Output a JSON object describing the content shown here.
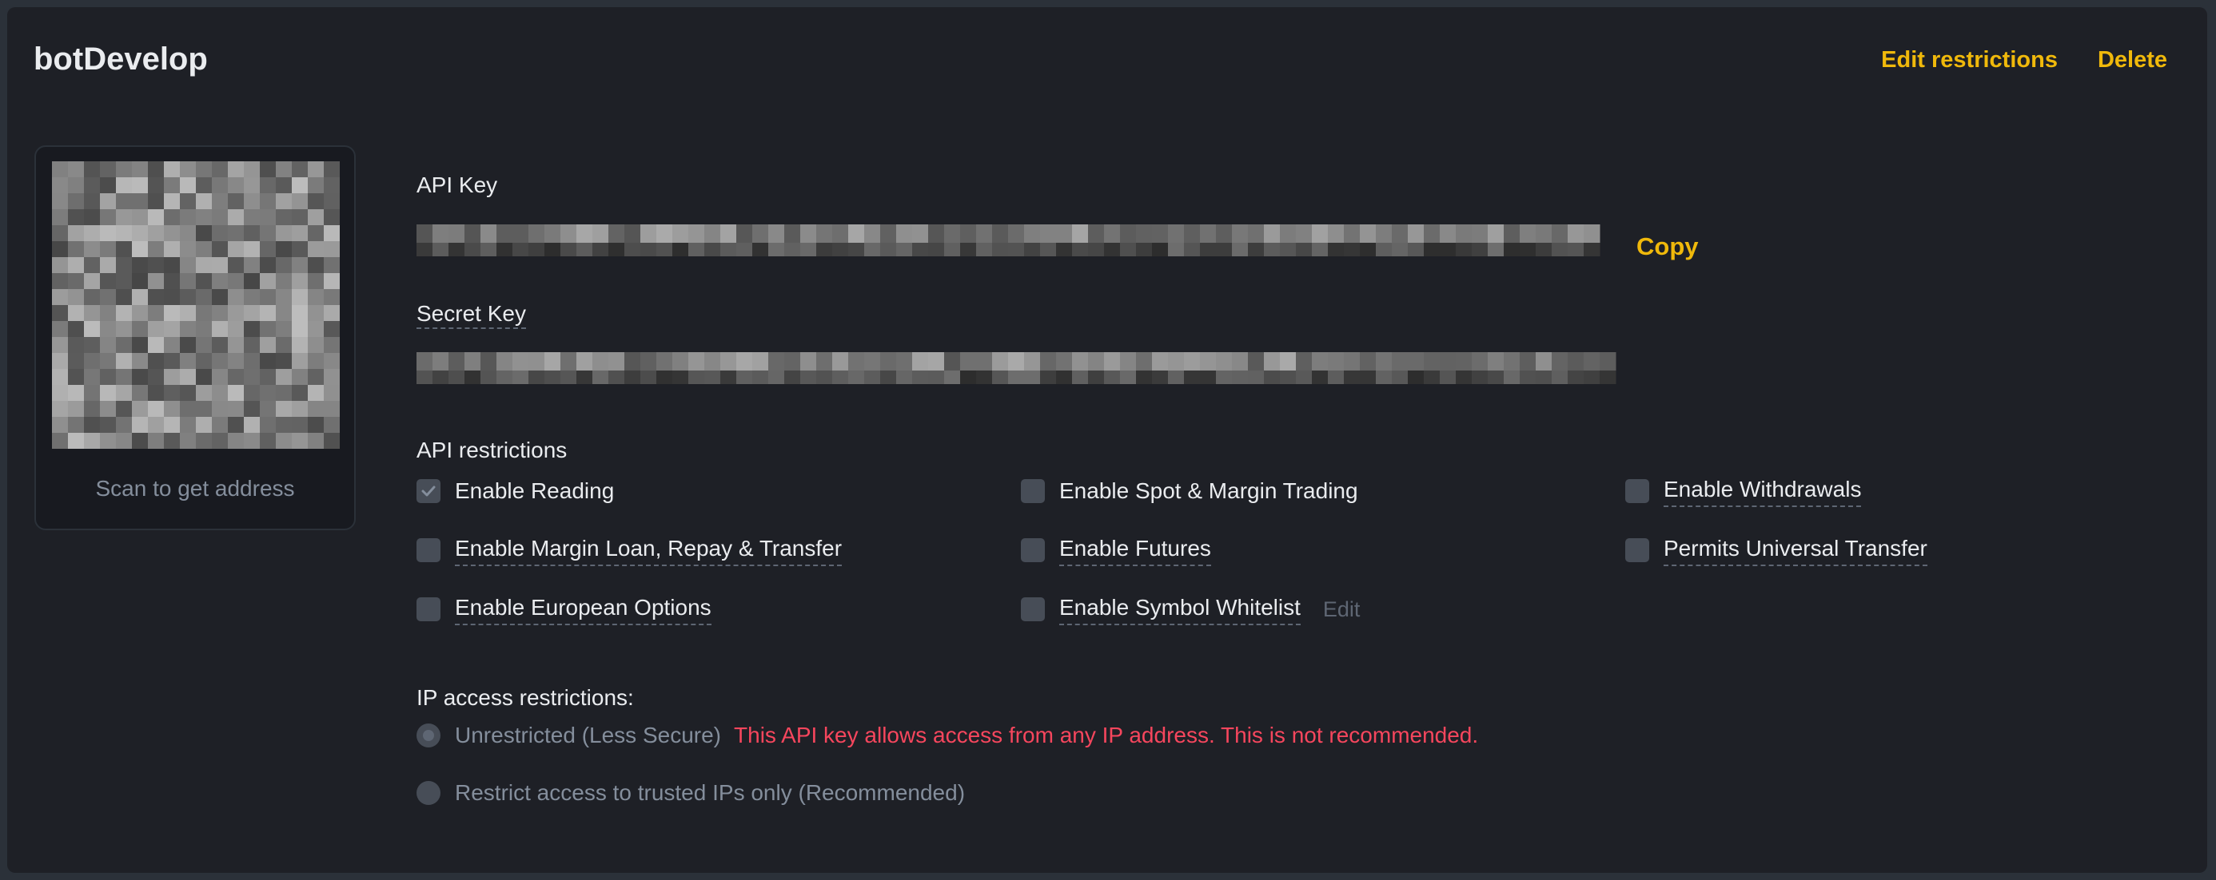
{
  "key_name": "botDevelop",
  "header": {
    "edit_label": "Edit restrictions",
    "delete_label": "Delete"
  },
  "qr": {
    "caption": "Scan to get address"
  },
  "api_key": {
    "label": "API Key",
    "copy_label": "Copy"
  },
  "secret_key": {
    "label": "Secret Key"
  },
  "restrictions": {
    "title": "API restrictions",
    "items": [
      {
        "label": "Enable Reading",
        "checked": true
      },
      {
        "label": "Enable Spot & Margin Trading",
        "checked": false
      },
      {
        "label": "Enable Withdrawals",
        "checked": false
      },
      {
        "label": "Enable Margin Loan, Repay & Transfer",
        "checked": false
      },
      {
        "label": "Enable Futures",
        "checked": false
      },
      {
        "label": "Permits Universal Transfer",
        "checked": false
      },
      {
        "label": "Enable European Options",
        "checked": false
      },
      {
        "label": "Enable Symbol Whitelist",
        "checked": false
      }
    ],
    "whitelist_edit_label": "Edit"
  },
  "ip_access": {
    "title": "IP access restrictions:",
    "options": [
      {
        "label": "Unrestricted (Less Secure)",
        "selected": true
      },
      {
        "label": "Restrict access to trusted IPs only (Recommended)",
        "selected": false
      }
    ],
    "warning": "This API key allows access from any IP address. This is not recommended."
  },
  "colors": {
    "accent": "#f0b90b",
    "warning": "#f6465d",
    "card_bg": "#1e2026",
    "page_bg": "#2b3139"
  },
  "icons": {
    "check": "check-icon",
    "qr": "qr-code-icon"
  }
}
